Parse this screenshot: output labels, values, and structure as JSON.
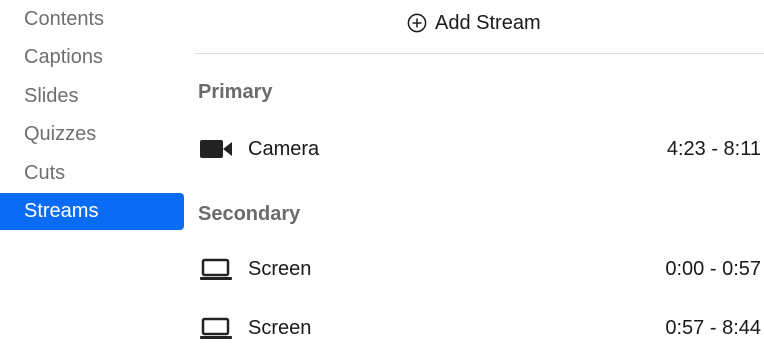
{
  "sidebar": {
    "items": [
      {
        "label": "Contents",
        "icon": "",
        "active": false
      },
      {
        "label": "Captions",
        "icon": "",
        "active": false
      },
      {
        "label": "Slides",
        "icon": "",
        "active": false
      },
      {
        "label": "Quizzes",
        "icon": "",
        "active": false
      },
      {
        "label": "Cuts",
        "icon": "",
        "active": false
      },
      {
        "label": "Streams",
        "icon": "",
        "active": true
      }
    ],
    "accent_color": "#0a6cf5"
  },
  "main": {
    "add_stream": {
      "label": "Add Stream",
      "icon": "plus-circle-icon"
    },
    "sections": [
      {
        "title": "Primary",
        "streams": [
          {
            "name": "Camera",
            "icon": "video-camera-icon",
            "range": "4:23 - 8:11"
          }
        ]
      },
      {
        "title": "Secondary",
        "streams": [
          {
            "name": "Screen",
            "icon": "laptop-icon",
            "range": "0:00 - 0:57"
          },
          {
            "name": "Screen",
            "icon": "laptop-icon",
            "range": "0:57 - 8:44"
          }
        ]
      }
    ]
  }
}
